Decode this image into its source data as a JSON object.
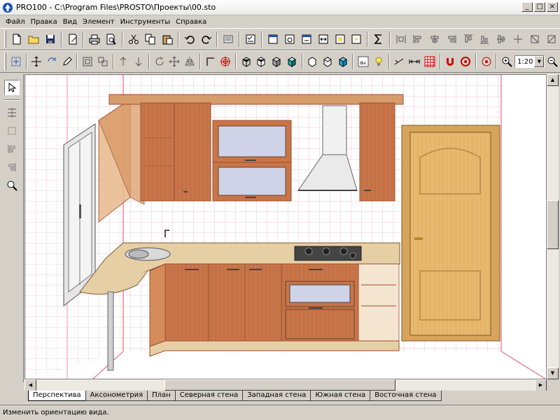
{
  "window": {
    "title": "PRO100 - C:\\Program Files\\PROSTO\\Проекты\\00.sto",
    "minimize": "_",
    "maximize": "□",
    "close": "×"
  },
  "menu": [
    "Файл",
    "Правка",
    "Вид",
    "Элемент",
    "Инструменты",
    "Справка"
  ],
  "toolbar1": {
    "icons": [
      "new-file-icon",
      "open-folder-icon",
      "save-icon",
      "edit-doc-icon",
      "print-icon",
      "print-preview-icon",
      "cut-icon",
      "copy-icon",
      "paste-icon",
      "undo-icon",
      "redo-icon",
      "catalog-icon",
      "properties-icon",
      "view-icon-a",
      "view-icon-b",
      "view-icon-c",
      "view-icon-d",
      "view-icon-e",
      "sum-icon",
      "align-icon-a",
      "align-icon-b",
      "align-icon-c",
      "align-icon-d",
      "align-icon-e",
      "align-icon-f",
      "align-icon-g",
      "align-icon-h",
      "align-icon-i",
      "align-icon-j"
    ]
  },
  "toolbar2": {
    "zoom_value": "1:20"
  },
  "canvas": {
    "grid_color": "#f2c7cf",
    "wall_color": "#f0a6b3",
    "cabinet_color": "#c8754a",
    "cabinet_dark": "#9c4e2c",
    "door_color": "#e6b56c"
  },
  "tabs": [
    "Перспектива",
    "Аксонометрия",
    "План",
    "Северная стена",
    "Западная стена",
    "Южная стена",
    "Восточная стена"
  ],
  "status": {
    "text": "Изменить ориентацию вида."
  }
}
